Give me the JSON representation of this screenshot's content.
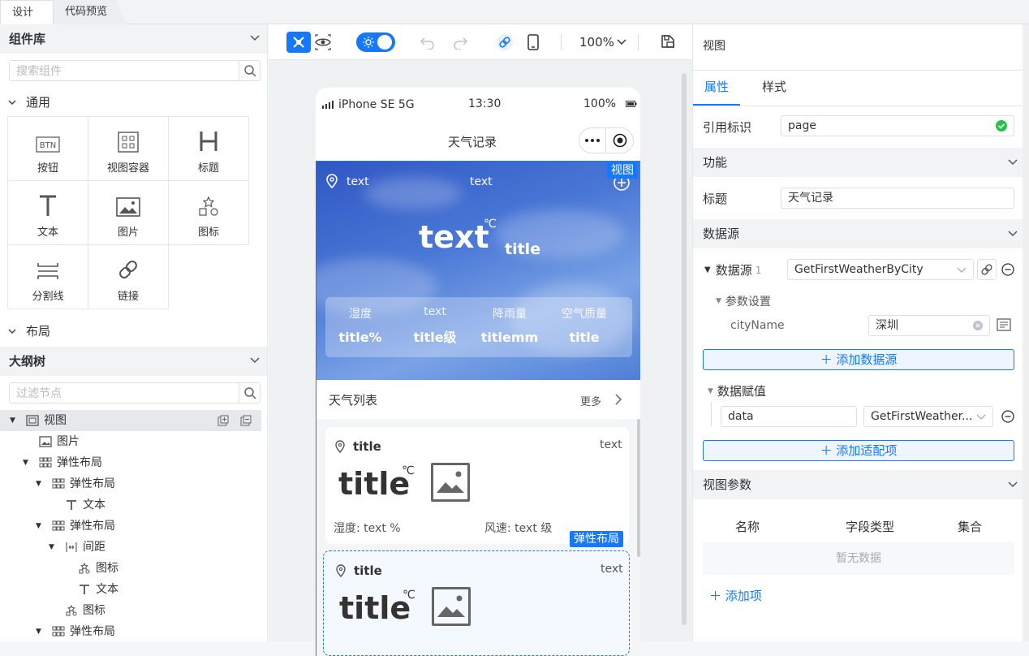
{
  "tabs": {
    "design": "设计",
    "code": "代码预览"
  },
  "left": {
    "library_title": "组件库",
    "search_placeholder": "搜索组件",
    "group_general": "通用",
    "components": [
      "按钮",
      "视图容器",
      "标题",
      "文本",
      "图片",
      "图标",
      "分割线",
      "链接"
    ],
    "btn_icon_text": "BTN",
    "group_layout": "布局",
    "outline_title": "大纲树",
    "filter_placeholder": "过滤节点",
    "tree": [
      {
        "label": "视图",
        "icon": "view-icon",
        "depth": 0,
        "caret": true
      },
      {
        "label": "图片",
        "icon": "image-icon",
        "depth": 1,
        "caret": false
      },
      {
        "label": "弹性布局",
        "icon": "flex-layout-icon",
        "depth": 1,
        "caret": true
      },
      {
        "label": "弹性布局",
        "icon": "flex-layout-icon",
        "depth": 2,
        "caret": true
      },
      {
        "label": "文本",
        "icon": "text-icon",
        "depth": 3,
        "caret": false
      },
      {
        "label": "弹性布局",
        "icon": "flex-layout-icon",
        "depth": 2,
        "caret": true
      },
      {
        "label": "间距",
        "icon": "spacing-icon",
        "depth": 3,
        "caret": true
      },
      {
        "label": "图标",
        "icon": "icon-component-icon",
        "depth": 4,
        "caret": false
      },
      {
        "label": "文本",
        "icon": "text-icon",
        "depth": 4,
        "caret": false
      },
      {
        "label": "图标",
        "icon": "icon-component-icon",
        "depth": 3,
        "caret": false
      },
      {
        "label": "弹性布局",
        "icon": "flex-layout-icon",
        "depth": 2,
        "caret": true
      }
    ]
  },
  "toolbar": {
    "zoom": "100%"
  },
  "phone": {
    "device": "iPhone SE 5G",
    "time": "13:30",
    "battery": "100%",
    "page_title": "天气记录",
    "hero": {
      "location": "text",
      "center_text": "text",
      "temp": "text",
      "unit": "℃",
      "cond": "title",
      "metrics": [
        {
          "label": "湿度",
          "value": "title%"
        },
        {
          "label": "text",
          "value": "title级"
        },
        {
          "label": "降雨量",
          "value": "titlemm"
        },
        {
          "label": "空气质量",
          "value": "title"
        }
      ]
    },
    "view_badge": "视图",
    "list_title": "天气列表",
    "more": "更多",
    "cards": [
      {
        "title": "title",
        "right": "text",
        "temp": "title",
        "unit": "℃",
        "humidity_label": "湿度:",
        "humidity": "text %",
        "wind_label": "风速:",
        "wind": "text 级"
      },
      {
        "title": "title",
        "right": "text",
        "temp": "title",
        "unit": "℃"
      }
    ],
    "flex_badge": "弹性布局"
  },
  "right": {
    "header": "视图",
    "tab_props": "属性",
    "tab_style": "样式",
    "ref_label": "引用标识",
    "ref_value": "page",
    "func_section": "功能",
    "title_label": "标题",
    "title_value": "天气记录",
    "ds_section": "数据源",
    "ds_label": "数据源",
    "ds_count": "1",
    "ds_value": "GetFirstWeatherByCity",
    "param_label": "参数设置",
    "param_name": "cityName",
    "param_value": "深圳",
    "add_ds": "添加数据源",
    "assign_label": "数据赋值",
    "assign_key": "data",
    "assign_value": "GetFirstWeather...",
    "add_adapter": "添加适配项",
    "view_params": "视图参数",
    "col_name": "名称",
    "col_type": "字段类型",
    "col_set": "集合",
    "empty": "暂无数据",
    "add_item": "添加项"
  },
  "colors": {
    "accent": "#1677ff",
    "success": "#27c24c"
  }
}
